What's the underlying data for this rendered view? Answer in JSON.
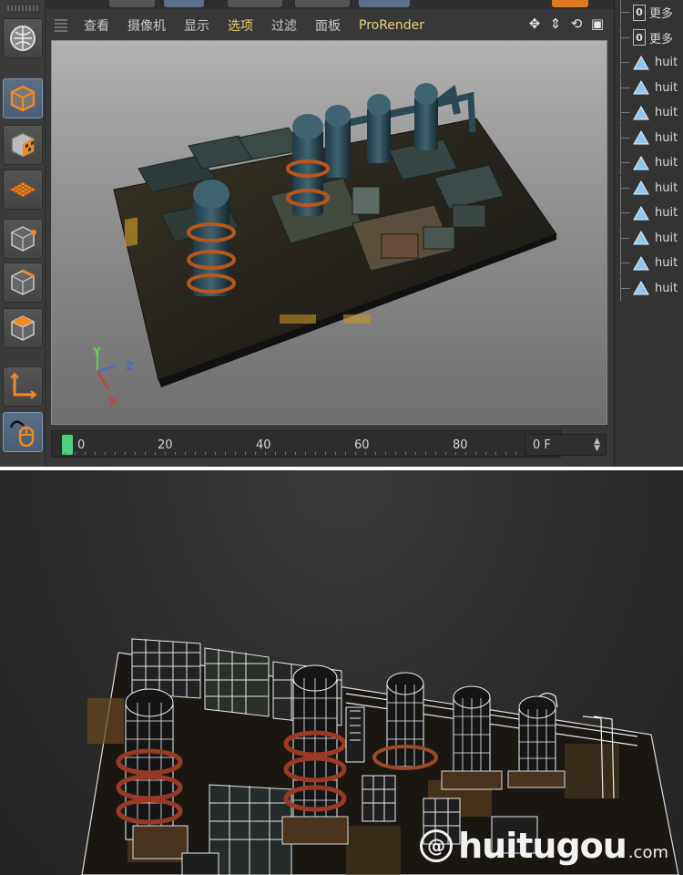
{
  "menubar": {
    "items": [
      "查看",
      "摄像机",
      "显示",
      "选项",
      "过滤",
      "面板",
      "ProRender"
    ],
    "selected_index": 3
  },
  "viewport_axes": {
    "y": "Y",
    "z": "Z",
    "x": "X"
  },
  "timeline": {
    "ticks": [
      "0",
      "20",
      "40",
      "60",
      "80"
    ],
    "current_frame": "0 F"
  },
  "object_manager": {
    "rows": [
      {
        "icon": "null-icon",
        "label": "更多"
      },
      {
        "icon": "null-icon",
        "label": "更多"
      },
      {
        "icon": "polygon-icon",
        "label": "huit"
      },
      {
        "icon": "polygon-icon",
        "label": "huit"
      },
      {
        "icon": "polygon-icon",
        "label": "huit"
      },
      {
        "icon": "polygon-icon",
        "label": "huit"
      },
      {
        "icon": "polygon-icon",
        "label": "huit"
      },
      {
        "icon": "polygon-icon",
        "label": "huit"
      },
      {
        "icon": "polygon-icon",
        "label": "huit"
      },
      {
        "icon": "polygon-icon",
        "label": "huit"
      },
      {
        "icon": "polygon-icon",
        "label": "huit"
      },
      {
        "icon": "polygon-icon",
        "label": "huit"
      }
    ]
  },
  "toolbar": {
    "tools": [
      "view-mode-icon",
      "cube-object-icon",
      "texture-checker-icon",
      "grid-plane-icon",
      "points-mode-icon",
      "edges-mode-icon",
      "polygons-mode-icon",
      "axis-mode-icon",
      "mouse-tool-icon"
    ]
  },
  "watermark": {
    "logo": "@",
    "text": "huitugou",
    "domain": ".com"
  },
  "colors": {
    "accent": "#e9d36a",
    "selection_orange": "#f08a24",
    "timeline_marker": "#4fd07d",
    "active_tool": "#5a6f86"
  }
}
